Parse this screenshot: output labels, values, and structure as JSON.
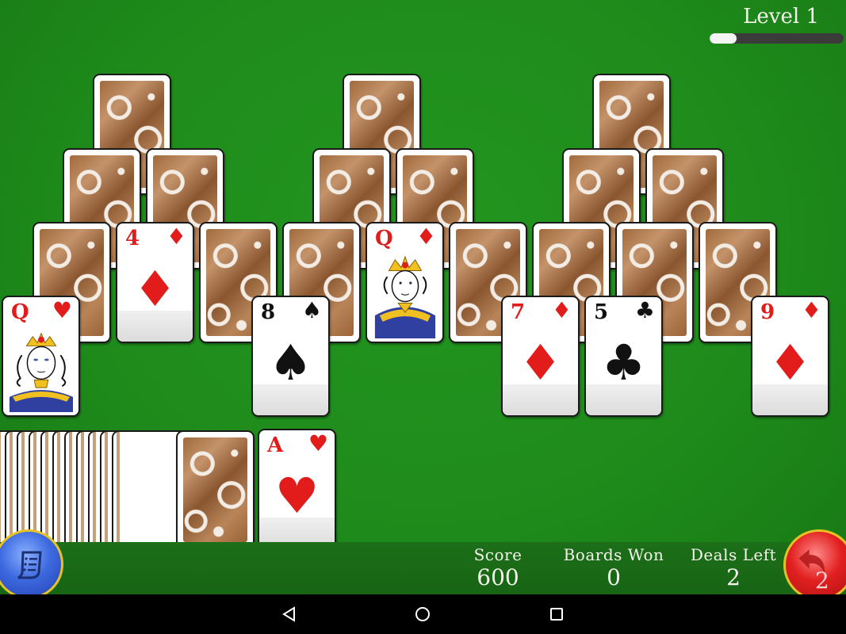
{
  "game": {
    "level_label": "Level 1",
    "level_progress_fraction": 0.2
  },
  "tableau": {
    "peaks": [
      {
        "row": 1,
        "cards": [
          {
            "face_up": false
          },
          {
            "face_up": false
          },
          {
            "face_up": false
          }
        ]
      },
      {
        "row": 2,
        "cards": [
          {
            "face_up": false
          },
          {
            "face_up": false
          },
          {
            "face_up": false
          },
          {
            "face_up": false
          },
          {
            "face_up": false
          },
          {
            "face_up": false
          }
        ]
      },
      {
        "row": 3,
        "cards": [
          {
            "face_up": false
          },
          {
            "face_up": true,
            "rank": "4",
            "suit": "♦",
            "color": "red"
          },
          {
            "face_up": false
          },
          {
            "face_up": false
          },
          {
            "face_up": true,
            "rank": "Q",
            "suit": "♦",
            "color": "red"
          },
          {
            "face_up": false
          },
          {
            "face_up": false
          },
          {
            "face_up": false
          },
          {
            "face_up": false
          }
        ]
      },
      {
        "row": 4,
        "cards": [
          {
            "face_up": true,
            "rank": "Q",
            "suit": "♥",
            "color": "red"
          },
          {
            "face_up": true,
            "rank": "8",
            "suit": "♠",
            "color": "black"
          },
          {
            "face_up": true,
            "rank": "7",
            "suit": "♦",
            "color": "red"
          },
          {
            "face_up": true,
            "rank": "5",
            "suit": "♣",
            "color": "black"
          },
          {
            "face_up": true,
            "rank": "9",
            "suit": "♦",
            "color": "red"
          }
        ]
      }
    ]
  },
  "stock": {
    "visible_card_edges": 16
  },
  "waste": {
    "rank": "A",
    "suit": "♥",
    "color": "red"
  },
  "hud": {
    "score_label": "Score",
    "score_value": "600",
    "boards_won_label": "Boards Won",
    "boards_won_value": "0",
    "deals_left_label": "Deals Left",
    "deals_left_value": "2",
    "undo_count": "2",
    "menu_icon": "scroll-list-icon",
    "undo_icon": "undo-arrow-icon"
  },
  "navbar": {
    "back_icon": "triangle-back-icon",
    "home_icon": "circle-home-icon",
    "recents_icon": "square-recents-icon"
  },
  "colors": {
    "felt": "#1f8a1c",
    "red_suit": "#e21b1b",
    "black_suit": "#111111",
    "menu_button": "#3d6ae0",
    "undo_button": "#e22020",
    "button_rim": "#e8c224"
  }
}
